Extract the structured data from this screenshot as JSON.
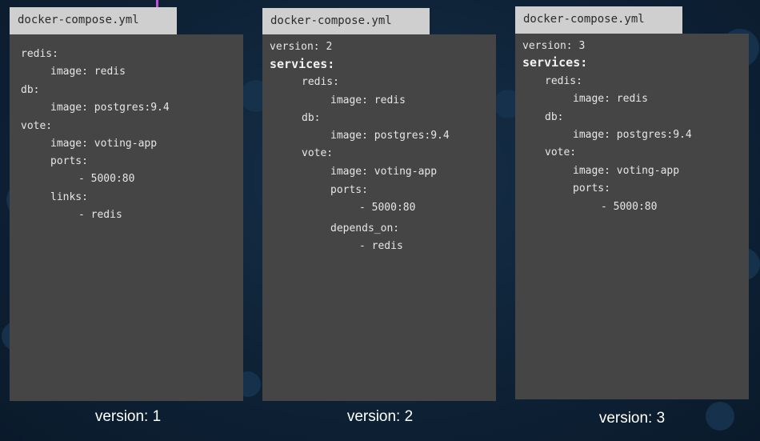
{
  "background": {
    "accent_color": "#c24fd8"
  },
  "panels": [
    {
      "filename": "docker-compose.yml",
      "caption": "version: 1",
      "lines": [
        {
          "text": "redis:",
          "indent": 0
        },
        {
          "text": "image: redis",
          "indent": 1
        },
        {
          "text": "db:",
          "indent": 0
        },
        {
          "text": "image: postgres:9.4",
          "indent": 1
        },
        {
          "text": "vote:",
          "indent": 0
        },
        {
          "text": "image: voting-app",
          "indent": 1
        },
        {
          "text": "ports:",
          "indent": 1
        },
        {
          "text": "- 5000:80",
          "indent": 2
        },
        {
          "text": "links:",
          "indent": 1
        },
        {
          "text": "- redis",
          "indent": 2
        }
      ]
    },
    {
      "filename": "docker-compose.yml",
      "caption": "version: 2",
      "lines": [
        {
          "text": "version: 2",
          "indent": 0
        },
        {
          "text": "services:",
          "indent": 0,
          "emphasis": true
        },
        {
          "text": "redis:",
          "indent": 1
        },
        {
          "text": "image: redis",
          "indent": 2
        },
        {
          "text": "db:",
          "indent": 1
        },
        {
          "text": "image: postgres:9.4",
          "indent": 2
        },
        {
          "text": "vote:",
          "indent": 1
        },
        {
          "text": "image: voting-app",
          "indent": 2
        },
        {
          "text": "ports:",
          "indent": 2
        },
        {
          "text": "- 5000:80",
          "indent": 3
        },
        {
          "text": "depends_on:",
          "indent": 2
        },
        {
          "text": "- redis",
          "indent": 3
        }
      ]
    },
    {
      "filename": "docker-compose.yml",
      "caption": "version: 3",
      "lines": [
        {
          "text": "version: 3",
          "indent": 0
        },
        {
          "text": "services:",
          "indent": 0,
          "emphasis": true
        },
        {
          "text": "redis:",
          "indent": 1
        },
        {
          "text": "image: redis",
          "indent": 2
        },
        {
          "text": "db:",
          "indent": 1
        },
        {
          "text": "image: postgres:9.4",
          "indent": 2
        },
        {
          "text": "vote:",
          "indent": 1
        },
        {
          "text": "image: voting-app",
          "indent": 2
        },
        {
          "text": "ports:",
          "indent": 2
        },
        {
          "text": "- 5000:80",
          "indent": 3
        }
      ]
    }
  ]
}
